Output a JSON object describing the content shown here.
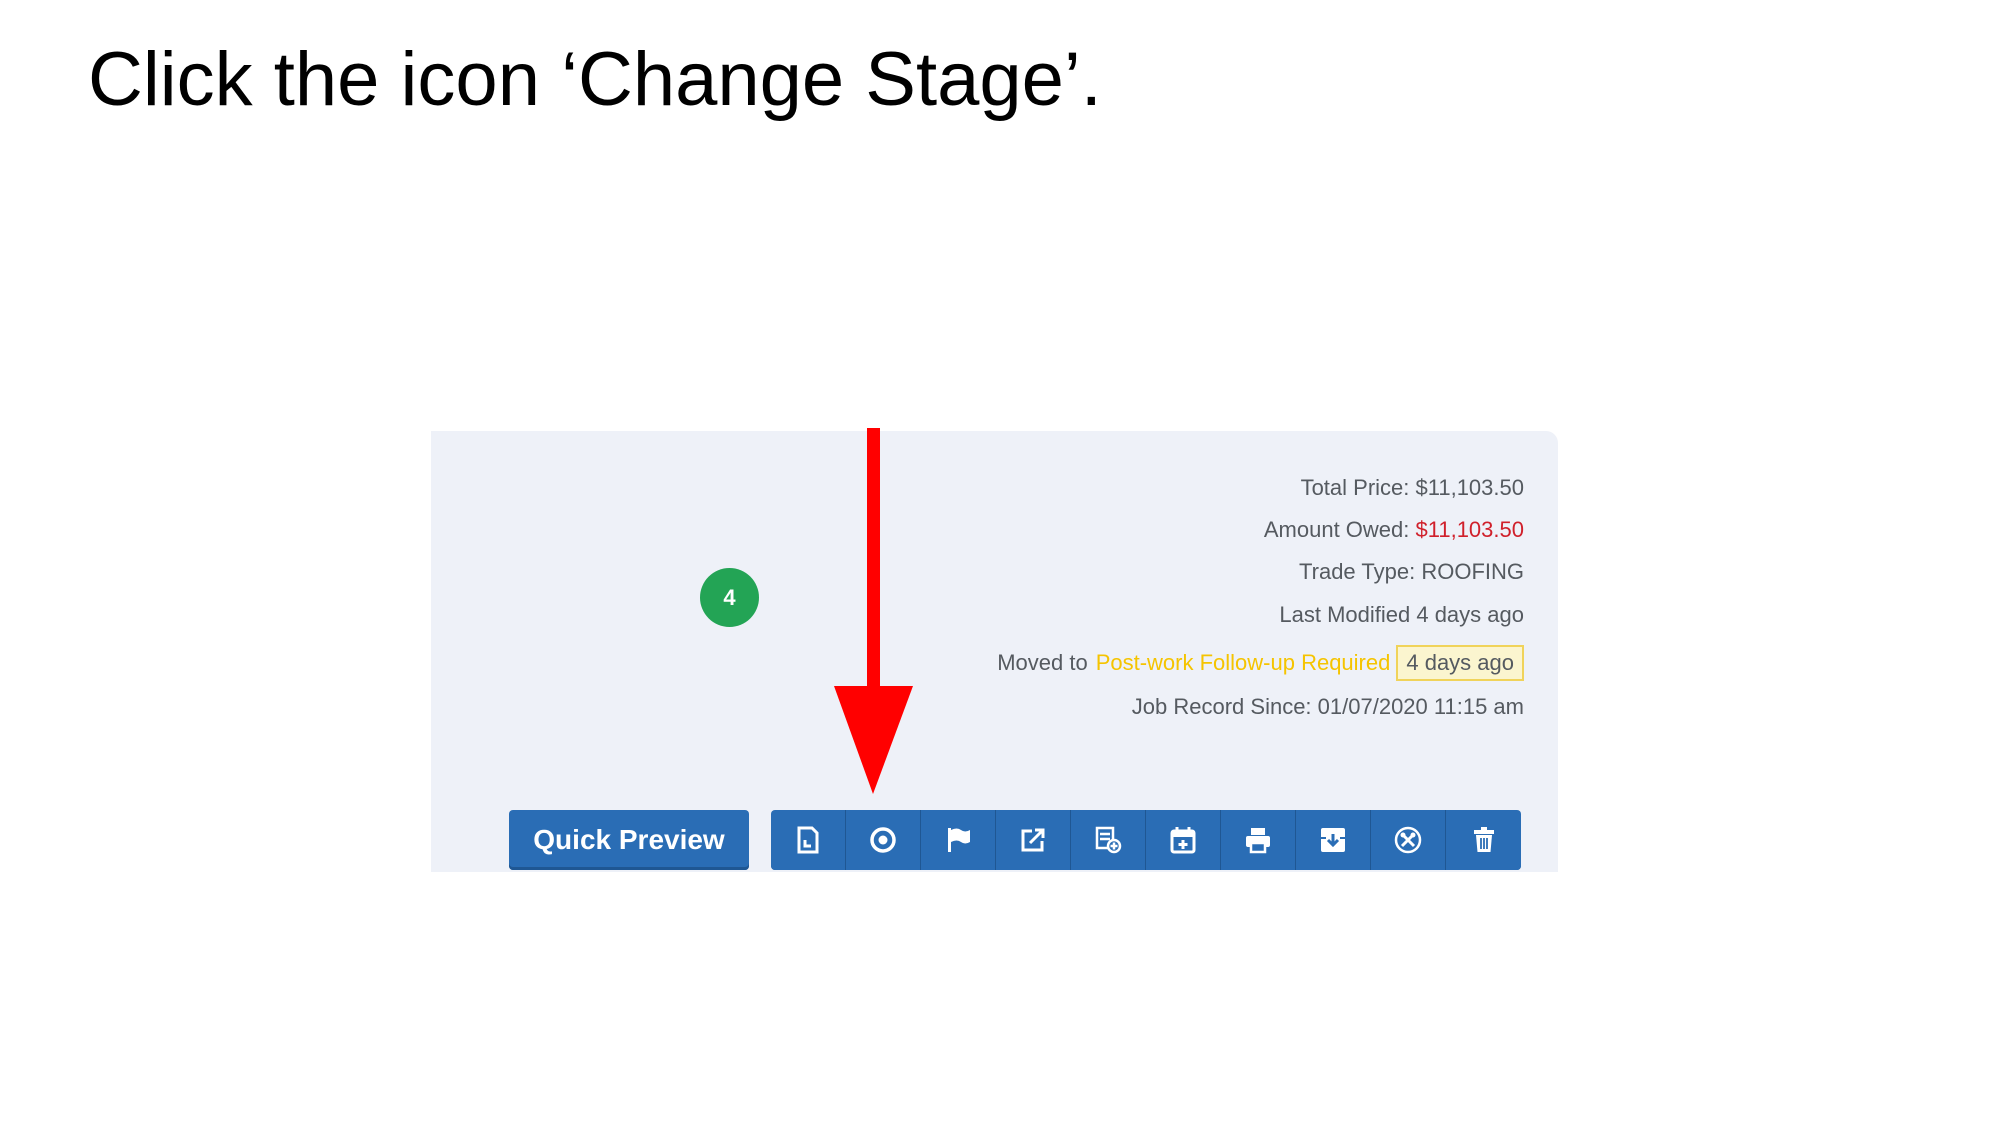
{
  "instruction": "Click the icon ‘Change Stage’.",
  "job_card": {
    "badge_count": "4",
    "total_price_label": "Total Price:",
    "total_price": "$11,103.50",
    "amount_owed_label": "Amount Owed:",
    "amount_owed": "$11,103.50",
    "trade_type_label": "Trade Type:",
    "trade_type": "ROOFING",
    "last_modified": "Last Modified 4 days ago",
    "moved_to_label": "Moved to",
    "moved_to_stage": "Post-work Follow-up Required",
    "moved_ago": "4 days ago",
    "record_since_label": "Job Record Since:",
    "record_since": "01/07/2020 11:15 am"
  },
  "actions": {
    "quick_preview_label": "Quick Preview",
    "icons": [
      "document-icon",
      "change-stage-icon",
      "flag-icon",
      "external-link-icon",
      "add-list-icon",
      "calendar-add-icon",
      "print-icon",
      "archive-icon",
      "tools-icon",
      "trash-icon"
    ]
  },
  "colors": {
    "button_blue": "#2a6db5",
    "badge_green": "#23a455",
    "owed_red": "#d0202b",
    "stage_yellow": "#f5c400",
    "arrow_red": "#ff0000",
    "card_bg": "#eef1f8"
  }
}
